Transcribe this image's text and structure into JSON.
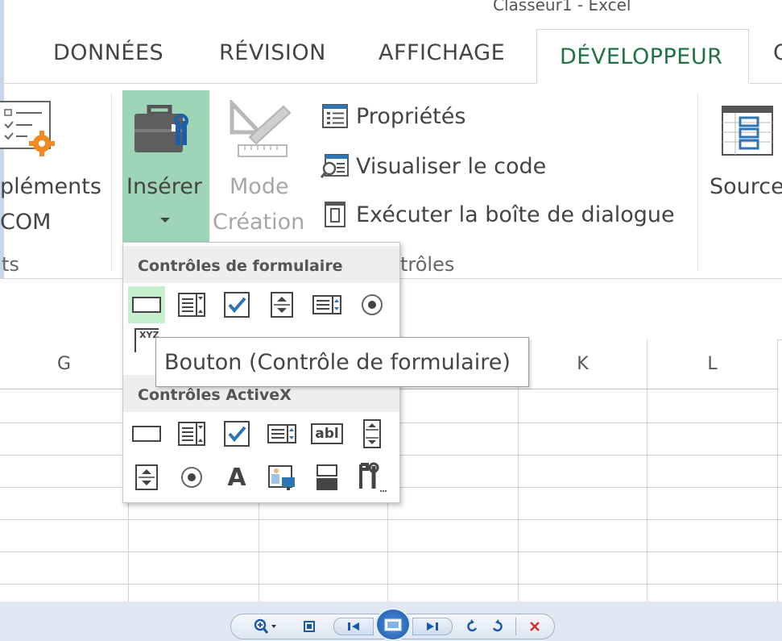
{
  "window": {
    "title": "Classeur1 - Excel"
  },
  "tabs": [
    {
      "label": "DONNÉES",
      "active": false
    },
    {
      "label": "RÉVISION",
      "active": false
    },
    {
      "label": "AFFICHAGE",
      "active": false
    },
    {
      "label": "DÉVELOPPEUR",
      "active": true
    },
    {
      "label": "C",
      "active": false
    }
  ],
  "ribbon": {
    "complements": {
      "line1": "pléments",
      "line2": "COM",
      "group_label": "ts"
    },
    "insert": {
      "label": "Insérer"
    },
    "mode": {
      "line1": "Mode",
      "line2": "Création"
    },
    "properties": {
      "label": "Propriétés"
    },
    "view_code": {
      "label": "Visualiser le code"
    },
    "run_dialog": {
      "label": "Exécuter la boîte de dialogue"
    },
    "controls_group_label": "trôles",
    "source": {
      "label": "Source"
    }
  },
  "dropdown": {
    "form_controls_header": "Contrôles de formulaire",
    "activex_header": "Contrôles ActiveX",
    "label_icon_text": "XYZ",
    "textbox_icon_text": "abl",
    "label_activex_text": "A"
  },
  "tooltip": {
    "text": "Bouton (Contrôle de formulaire)"
  },
  "columns": [
    "G",
    "K",
    "L"
  ],
  "colors": {
    "accent": "#217346",
    "insert_highlight": "#9fd5b7",
    "checkbox_blue": "#2e75b6"
  }
}
